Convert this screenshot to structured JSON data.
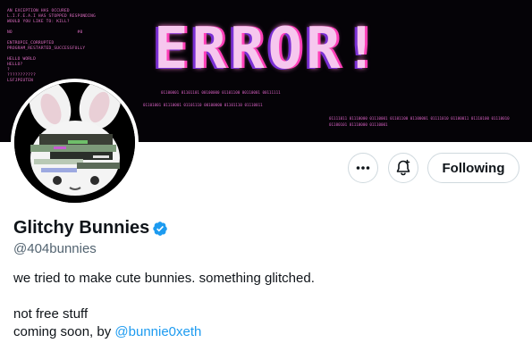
{
  "banner": {
    "headline": "ERROR!",
    "terminal_lines": [
      "AN EXCEPTION HAS OCCURED",
      "L.I.F.E.A.I HAS STOPPED RESPONDING",
      "WOULD YOU LIKE TO: KILL?",
      "",
      "NO                         #0",
      "",
      "ENTROPIE_CORRUPTED",
      "PROGRAM_RESTARTED_SUCCESSFULLY",
      "",
      "HELLO WORLD",
      "HELLO?",
      "?",
      "???????????",
      "LSFJPEUTEN"
    ],
    "bits_right": "01111011 01110000 01110001 01101100 01100001 01111010 01100011 01110100 01110010",
    "bits_right2": "01100101 01110000 01110001",
    "bits_mid": "01100001 01101101 00100000 01101100 00110001 00111111",
    "bits_mid2": "01101001 01110001 01101110 00100000 01101110 01110011"
  },
  "profile": {
    "name": "Glitchy Bunnies",
    "handle": "@404bunnies",
    "bio_line1": "we tried to make cute bunnies. something glitched.",
    "bio_line2": "not free stuff",
    "bio_line3_prefix": "coming soon, by ",
    "bio_line3_mention": "@bunnie0xeth"
  },
  "actions": {
    "more_icon": "more-icon",
    "notify_icon": "bell-plus-icon",
    "follow_label": "Following"
  },
  "colors": {
    "verified": "#1d9bf0",
    "mention": "#1d9bf0",
    "banner_accent": "#e36fc6"
  }
}
